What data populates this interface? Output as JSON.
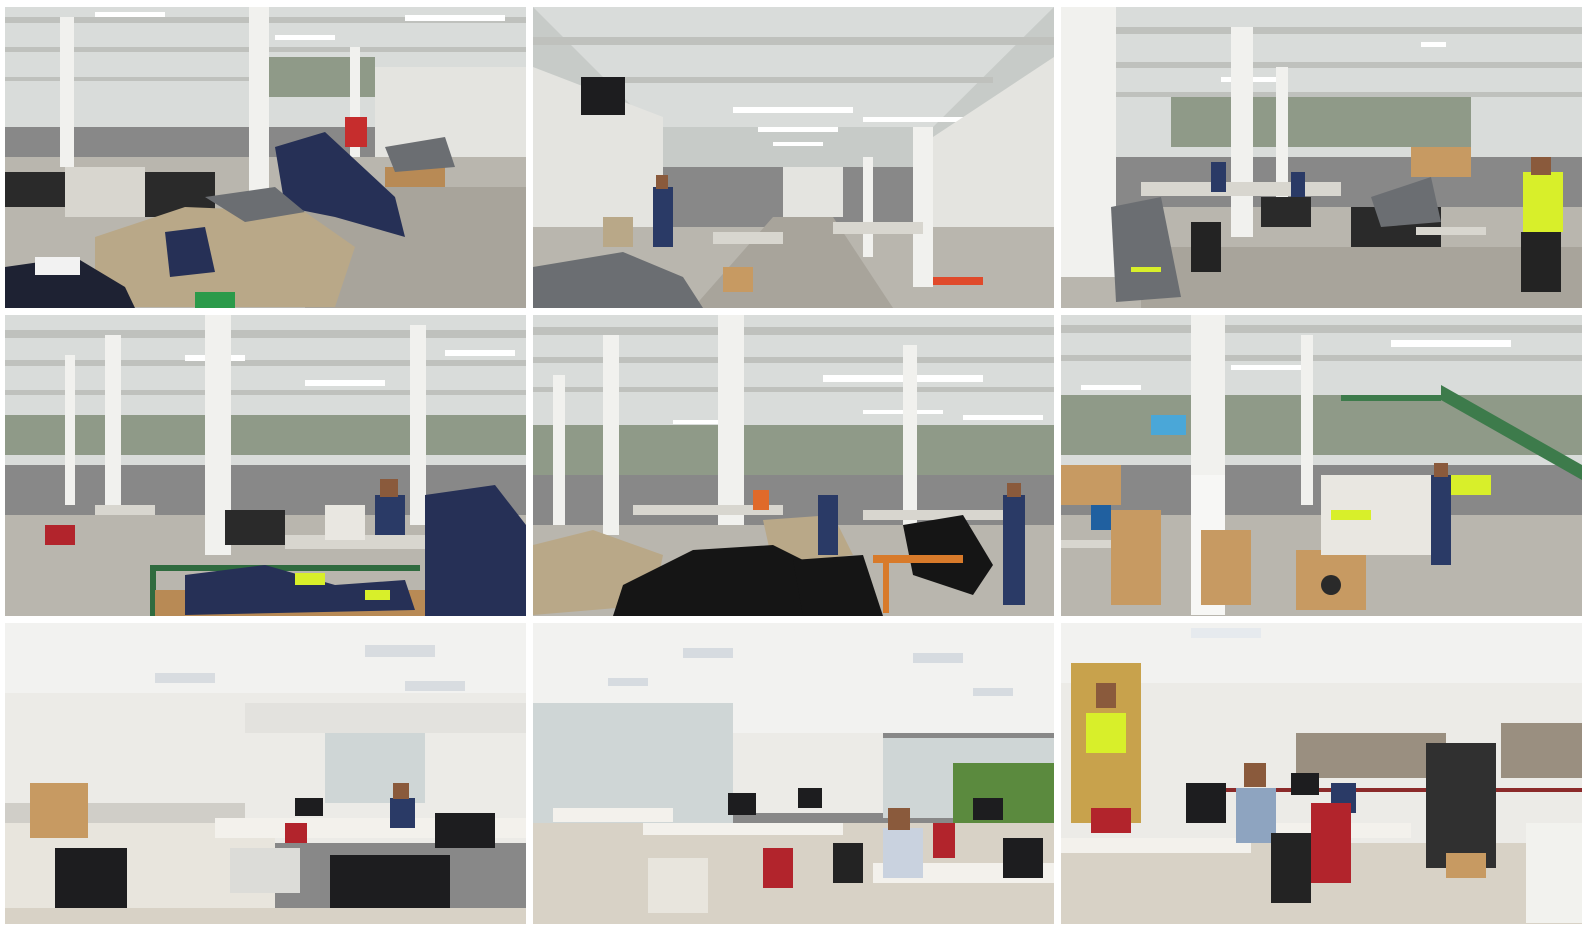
{
  "collage": {
    "photos": [
      {
        "id": "p1",
        "subject": "factory-floor-fabric-piles"
      },
      {
        "id": "p2",
        "subject": "factory-aisle-workstations"
      },
      {
        "id": "p3",
        "subject": "factory-sewing-area-hivis"
      },
      {
        "id": "p4",
        "subject": "sewing-machines-navy-fabric"
      },
      {
        "id": "p5",
        "subject": "sewing-hall-dark-fabric-piles"
      },
      {
        "id": "p6",
        "subject": "packing-area-green-stairs"
      },
      {
        "id": "p7",
        "subject": "office-printer-desks"
      },
      {
        "id": "p8",
        "subject": "open-plan-office"
      },
      {
        "id": "p9",
        "subject": "office-poster-workstations"
      }
    ]
  }
}
